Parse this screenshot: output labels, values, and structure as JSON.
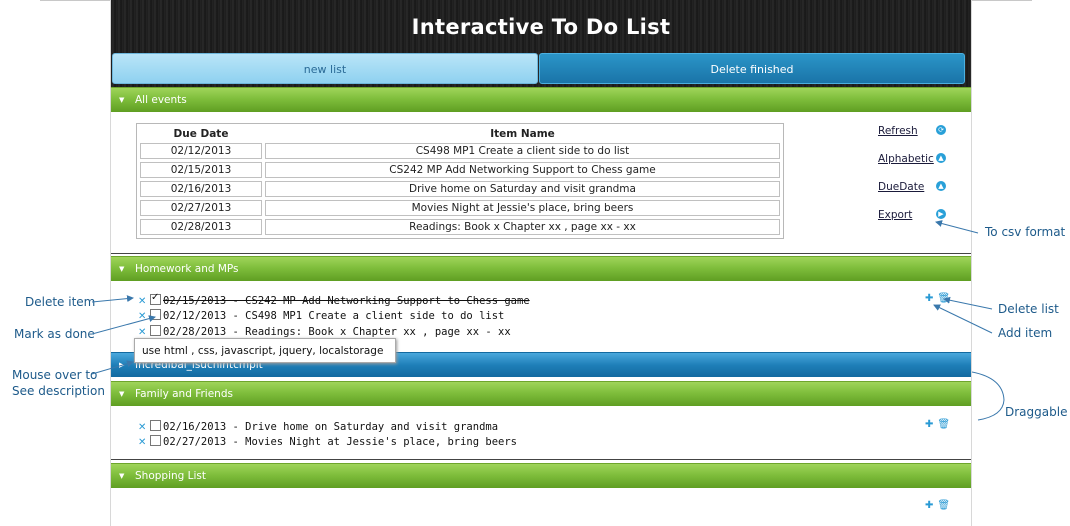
{
  "app": {
    "title": "Interactive To Do List",
    "new_list_label": "new list",
    "delete_finished_label": "Delete finished"
  },
  "all_events": {
    "title": "All events",
    "columns": [
      "Due Date",
      "Item Name"
    ],
    "rows": [
      {
        "date": "02/12/2013",
        "name": "CS498 MP1 Create a client side to do list"
      },
      {
        "date": "02/15/2013",
        "name": "CS242 MP Add Networking Support to Chess game"
      },
      {
        "date": "02/16/2013",
        "name": "Drive home on Saturday and visit grandma"
      },
      {
        "date": "02/27/2013",
        "name": "Movies Night at Jessie's place, bring beers"
      },
      {
        "date": "02/28/2013",
        "name": "Readings: Book x Chapter xx , page xx - xx"
      }
    ],
    "links": {
      "refresh": "Refresh",
      "alphabetic": "Alphabetic",
      "duedate": "DueDate",
      "export": "Export"
    }
  },
  "lists": {
    "homework": {
      "title": "Homework and MPs",
      "items": [
        {
          "text": "02/15/2013 - CS242 MP Add Networking Support to Chess game",
          "done": true
        },
        {
          "text": "02/12/2013 - CS498 MP1 Create a client side to do list",
          "done": false
        },
        {
          "text": "02/28/2013 - Readings: Book x Chapter xx , page xx - xx",
          "done": false
        }
      ]
    },
    "incredibal": {
      "title": "Incredibal_isuchintcmpit"
    },
    "family": {
      "title": "Family and Friends",
      "items": [
        {
          "text": "02/16/2013 - Drive home on Saturday and visit grandma",
          "done": false
        },
        {
          "text": "02/27/2013 - Movies Night at Jessie's place, bring beers",
          "done": false
        }
      ]
    },
    "shopping": {
      "title": "Shopping List"
    }
  },
  "tooltip": "use html , css, javascript, jquery, localstorage",
  "annotations": {
    "delete_item": "Delete item",
    "mark_done": "Mark as done",
    "mouse_over_1": "Mouse over to",
    "mouse_over_2": "See description",
    "to_csv": "To csv format",
    "delete_list": "Delete list",
    "add_item": "Add item",
    "draggable": "Draggable"
  },
  "icons": {
    "delete_item": "close-icon",
    "add_item": "plus-icon",
    "delete_list": "trash-icon",
    "section_toggle": "triangle-down-icon",
    "side_action": "circle-arrow-icon"
  },
  "colors": {
    "section_green": "#7fbe3c",
    "section_blue": "#1f7fb8",
    "header_dark": "#1b1b1b",
    "accent_blue": "#29a0d8",
    "annotation": "#1d5a8a"
  }
}
